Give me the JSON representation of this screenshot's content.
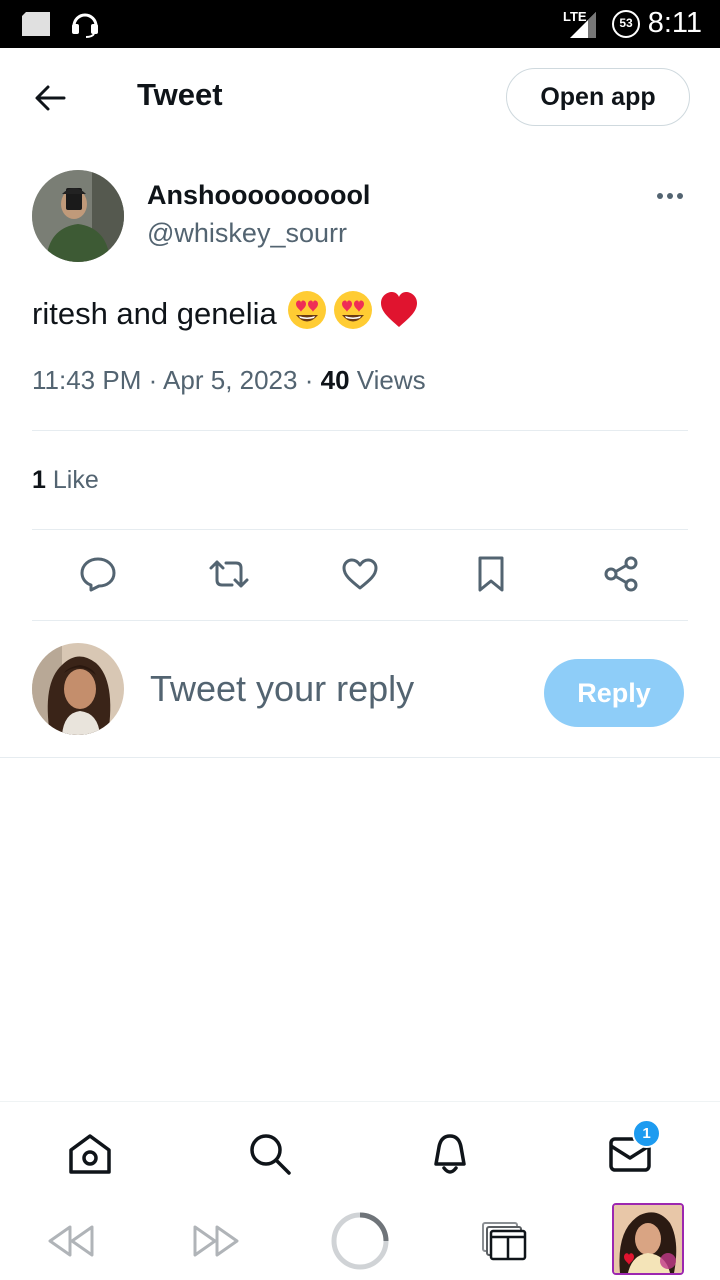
{
  "status_bar": {
    "time": "8:11",
    "network": "LTE",
    "battery": "53"
  },
  "header": {
    "title": "Tweet",
    "open_app_label": "Open app"
  },
  "tweet": {
    "author_name": "Anshoooooooool",
    "author_handle": "@whiskey_sourr",
    "text": "ritesh and genelia",
    "emojis": [
      "heart-eyes-emoji",
      "heart-eyes-emoji",
      "red-heart-emoji"
    ],
    "time": "11:43 PM",
    "date": "Apr 5, 2023",
    "views_count": "40",
    "views_label": "Views",
    "likes_count": "1",
    "likes_label": "Like"
  },
  "actions": [
    "reply-icon",
    "retweet-icon",
    "like-icon",
    "bookmark-icon",
    "share-icon"
  ],
  "reply": {
    "placeholder": "Tweet your reply",
    "button_label": "Reply"
  },
  "bottom_nav": {
    "items": [
      "home-icon",
      "search-icon",
      "notifications-icon",
      "messages-icon"
    ],
    "messages_badge": "1"
  },
  "browser_bar": {
    "items": [
      "rewind-icon",
      "fast-forward-icon",
      "loading-icon",
      "tabs-icon",
      "profile-thumbnail"
    ]
  },
  "colors": {
    "accent": "#1d9bf0",
    "reply_button": "#8ecdf8",
    "secondary_text": "#536471",
    "heart": "#f91880"
  }
}
